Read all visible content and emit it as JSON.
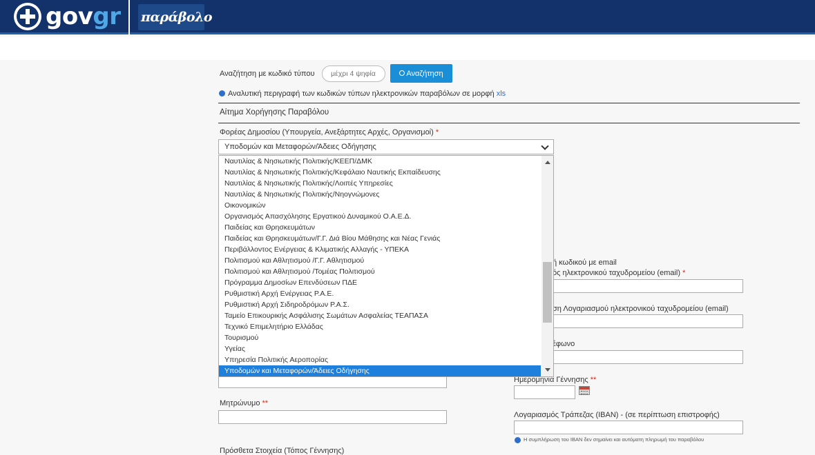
{
  "header": {
    "brand_gov": "gov",
    "brand_gr": "gr",
    "app_name": "παράβολο"
  },
  "search": {
    "label": "Αναζήτηση με κωδικό τύπου",
    "placeholder": "μέχρι 4 ψηφία",
    "button_label": "Αναζήτηση"
  },
  "info_line": {
    "text": "Αναλυτική περιγραφή των κωδικών τύπων ηλεκτρονικών παραβόλων σε μορφή",
    "link": "xls"
  },
  "section_title": "Αίτημα Χορήγησης Παραβόλου",
  "agency": {
    "label": "Φορέας Δημοσίου (Υπουργεία, Ανεξάρτητες Αρχές, Οργανισμοί)",
    "required": "*",
    "selected": "Υποδομών και Μεταφορών/Άδειες Οδήγησης"
  },
  "dropdown_options": [
    "Ναυτιλίας & Νησιωτικής Πολιτικής/ΚΕΕΠ/ΔΜΚ",
    "Ναυτιλίας & Νησιωτικής Πολιτικής/Κεφάλαιο Ναυτικής Εκπαίδευσης",
    "Ναυτιλίας & Νησιωτικής Πολιτικής/Λοιπές Υπηρεσίες",
    "Ναυτιλίας & Νησιωτικής Πολιτικής/Νηογνώμονες",
    "Οικονομικών",
    "Οργανισμός Απασχόλησης Εργατικού Δυναμικού Ο.Α.Ε.Δ.",
    "Παιδείας και Θρησκευμάτων",
    "Παιδείας και Θρησκευμάτων/Γ.Γ. Διά Βίου Μάθησης και Νέας Γενιάς",
    "Περιβάλλοντος Ενέργειας & Κλιματικής Αλλαγής - ΥΠΕΚΑ",
    "Πολιτισμού και Αθλητισμού /Γ.Γ. Αθλητισμού",
    "Πολιτισμού και Αθλητισμού /Τομέας Πολιτισμού",
    "Πρόγραμμα Δημοσίων Επενδύσεων ΠΔΕ",
    "Ρυθμιστική Αρχή Ενέργειας Ρ.Α.Ε.",
    "Ρυθμιστική Αρχή Σιδηροδρόμων Ρ.Α.Σ.",
    "Ταμείο Επικουρικής Ασφάλισης Σωμάτων Ασφαλείας ΤΕΑΠΑΣΑ",
    "Τεχνικό Επιμελητήριο Ελλάδας",
    "Τουρισμού",
    "Υγείας",
    "Υπηρεσία Πολιτικής Αεροπορίας",
    "Υποδομών και Μεταφορών/Άδειες Οδήγησης"
  ],
  "right_fields": {
    "email_code_partial": "ή κωδικού με email",
    "email_label_partial": "ός ηλεκτρονικού ταχυδρομείου (email)",
    "email_req": "*",
    "email_confirm_partial": "ση Λογαριασμού ηλεκτρονικού ταχυδρομείου (email)",
    "phone_partial": "έφωνο",
    "birth_date_label": "Ημερομηνία Γέννησης",
    "birth_req": "**",
    "iban_label": "Λογαριασμός Τράπεζας (IBAN) - (σε περίπτωση επιστροφής)",
    "iban_note": "Η συμπλήρωση του IBAN δεν σημαίνει και αυτόματη πληρωμή του παραβόλου"
  },
  "left_fields": {
    "mother_name_label": "Μητρώνυμο",
    "mother_req": "**",
    "extra_info_label": "Πρόσθετα Στοιχεία (Τόπος Γέννησης)"
  }
}
